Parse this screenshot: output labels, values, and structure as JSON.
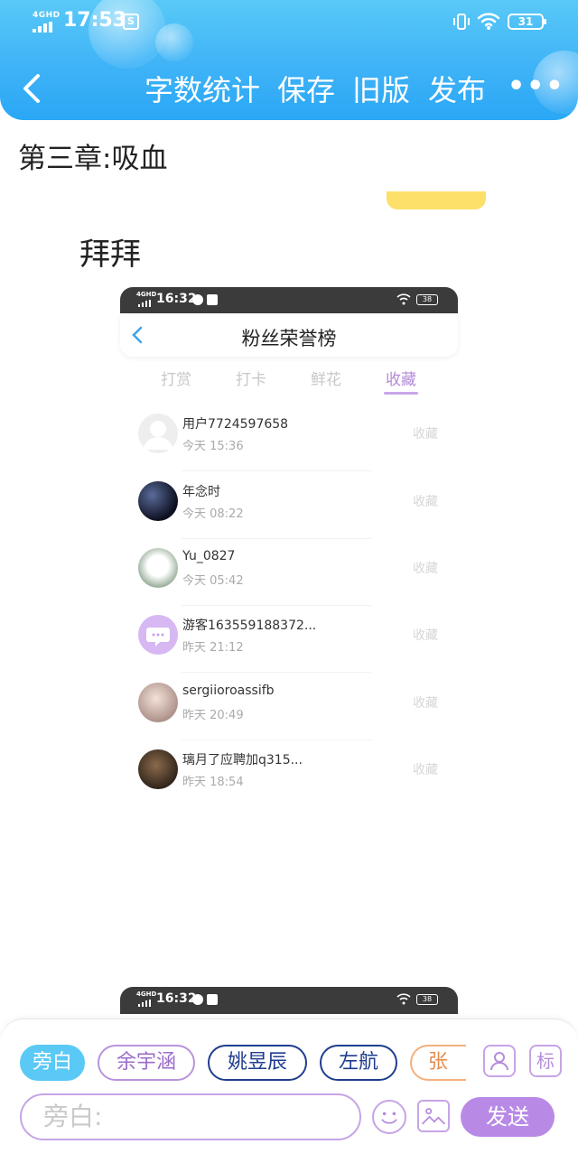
{
  "status_bar": {
    "signal": "4GHD",
    "time": "17:53",
    "battery": "31"
  },
  "header": {
    "word_count": "字数统计",
    "save": "保存",
    "old_version": "旧版",
    "publish": "发布",
    "more": "•••"
  },
  "content": {
    "chapter_title": "第三章:吸血",
    "paragraph": "拜拜"
  },
  "embedded_screenshot": {
    "status_time": "16:32",
    "status_signal": "4GHD",
    "status_battery": "38",
    "title": "粉丝荣誉榜",
    "tabs": [
      "打赏",
      "打卡",
      "鲜花",
      "收藏"
    ],
    "active_tab": "收藏",
    "rows": [
      {
        "name": "用户7724597658",
        "time": "今天 15:36",
        "action": "收藏"
      },
      {
        "name": "年念时",
        "time": "今天 08:22",
        "action": "收藏"
      },
      {
        "name": "Yu_0827",
        "time": "今天 05:42",
        "action": "收藏"
      },
      {
        "name": "游客163559188372...",
        "time": "昨天 21:12",
        "action": "收藏"
      },
      {
        "name": "sergiioroassifb",
        "time": "昨天 20:49",
        "action": "收藏"
      },
      {
        "name": "璃月了应聘加q315...",
        "time": "昨天 18:54",
        "action": "收藏"
      }
    ]
  },
  "embedded_screenshot_2": {
    "status_time": "16:32",
    "status_signal": "4GHD",
    "status_battery": "38"
  },
  "bottom_bar": {
    "characters": [
      "旁白",
      "余宇涵",
      "姚昱辰",
      "左航",
      "张峻"
    ],
    "tag_button": "标",
    "input_placeholder": "旁白:",
    "send": "发送"
  },
  "colors": {
    "header": "#3fb3f7",
    "accent_purple": "#b88ae6",
    "active_chip": "#5ac9f5"
  }
}
